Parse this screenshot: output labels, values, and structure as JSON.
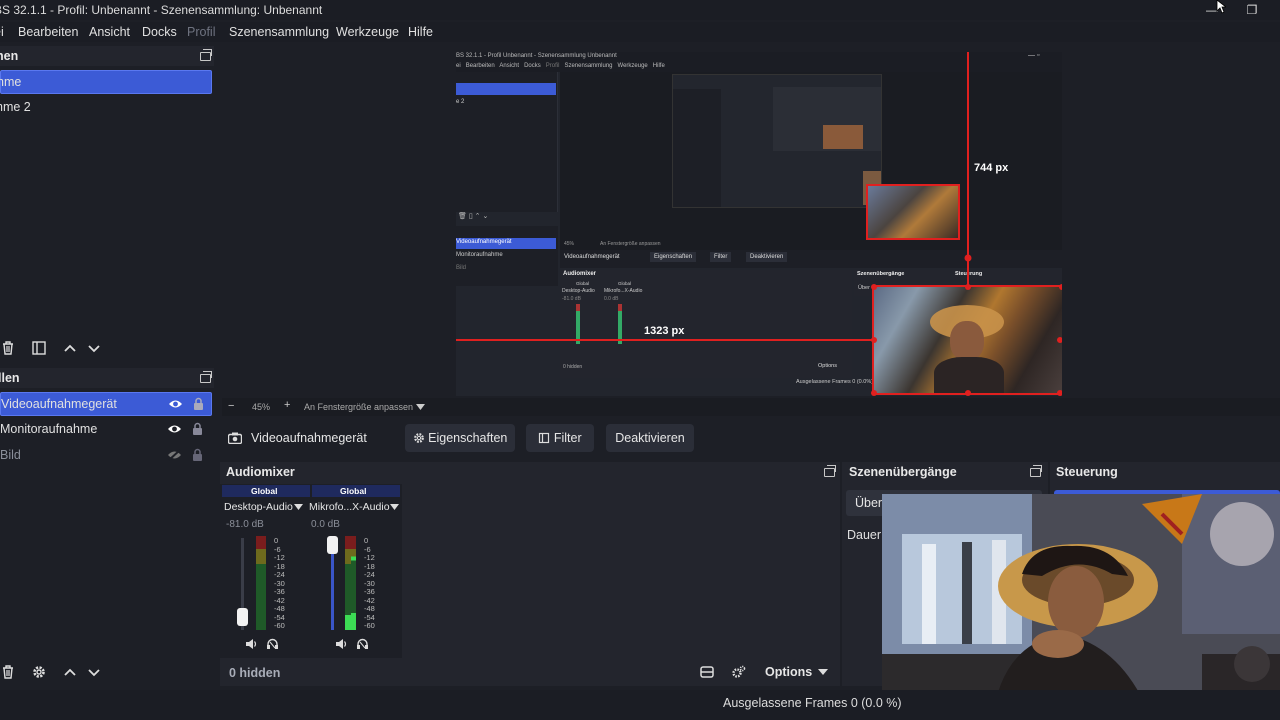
{
  "window": {
    "title": "BS 32.1.1 - Profil: Unbenannt - Szenensammlung: Unbenannt",
    "minimize_label": "—",
    "restore_label": "❐"
  },
  "menu": {
    "items": [
      {
        "label": "ei"
      },
      {
        "label": "Bearbeiten"
      },
      {
        "label": "Ansicht"
      },
      {
        "label": "Docks"
      },
      {
        "label": "Profil"
      },
      {
        "label": "Szenensammlung"
      },
      {
        "label": "Werkzeuge"
      },
      {
        "label": "Hilfe"
      }
    ]
  },
  "scenes": {
    "header": "nen",
    "items": [
      {
        "label": "hme"
      },
      {
        "label": "hme 2"
      }
    ]
  },
  "sources": {
    "header": "llen",
    "items": [
      {
        "label": "Videoaufnahmegerät"
      },
      {
        "label": "Monitoraufnahme"
      },
      {
        "label": "Bild"
      }
    ]
  },
  "preview": {
    "inner_title": "BS 32.1.1 - Profil Unbenannt - Szenensammlung Unbenannt",
    "inner_menu": [
      "ei",
      "Bearbeiten",
      "Ansicht",
      "Docks",
      "Profil",
      "Szenensammlung",
      "Werkzeuge",
      "Hilfe"
    ],
    "height_label": "744 px",
    "width_label": "1323 px",
    "inner_sources": [
      "Videoaufnahmegerät",
      "Monitoraufnahme",
      "Bild"
    ],
    "inner_source_name": "Videoaufnahmegerät",
    "inner_btns": [
      "Eigenschaften",
      "Filter",
      "Deaktivieren"
    ],
    "inner_mixer": "Audiomixer",
    "inner_transitions": "Szenenübergänge",
    "inner_controls": "Steuerung",
    "inner_transition_value": "Über",
    "inner_global": "Global",
    "inner_tracks": [
      "Desktop-Audio",
      "Mikrofo...X-Audio"
    ],
    "inner_levels": [
      "-81.0 dB",
      "0.0 dB"
    ],
    "inner_hidden": "0 hidden",
    "inner_options": "Options",
    "inner_zoom": "45%",
    "inner_fit": "An Fenstergröße anpassen",
    "inner_frames": "Ausgelassene Frames 0 (0.0%)"
  },
  "zoom": {
    "minus": "−",
    "value": "45%",
    "plus": "+",
    "fit_label": "An Fenstergröße anpassen"
  },
  "source_bar": {
    "name": "Videoaufnahmegerät",
    "properties": "Eigenschaften",
    "filter": "Filter",
    "deactivate": "Deaktivieren"
  },
  "mixer": {
    "header": "Audiomixer",
    "channels": [
      {
        "global": "Global",
        "name": "Desktop-Audio",
        "level": "-81.0 dB",
        "fader": 0.15
      },
      {
        "global": "Global",
        "name": "Mikrofo...X-Audio",
        "level": "0.0 dB",
        "fader": 1.0
      }
    ],
    "ticks": [
      "0",
      "-6",
      "-12",
      "-18",
      "-24",
      "-30",
      "-36",
      "-42",
      "-48",
      "-54",
      "-60"
    ],
    "hidden": "0 hidden",
    "options": "Options"
  },
  "transitions": {
    "header": "Szenenübergänge",
    "value": "Über",
    "duration_label": "Dauer"
  },
  "controls": {
    "header": "Steuerung"
  },
  "status": {
    "frames": "Ausgelassene Frames 0 (0.0 %)"
  },
  "colors": {
    "accent": "#3c5bd6",
    "guide": "#e0201f",
    "bg": "#1d1f26",
    "panel": "#23252d"
  }
}
